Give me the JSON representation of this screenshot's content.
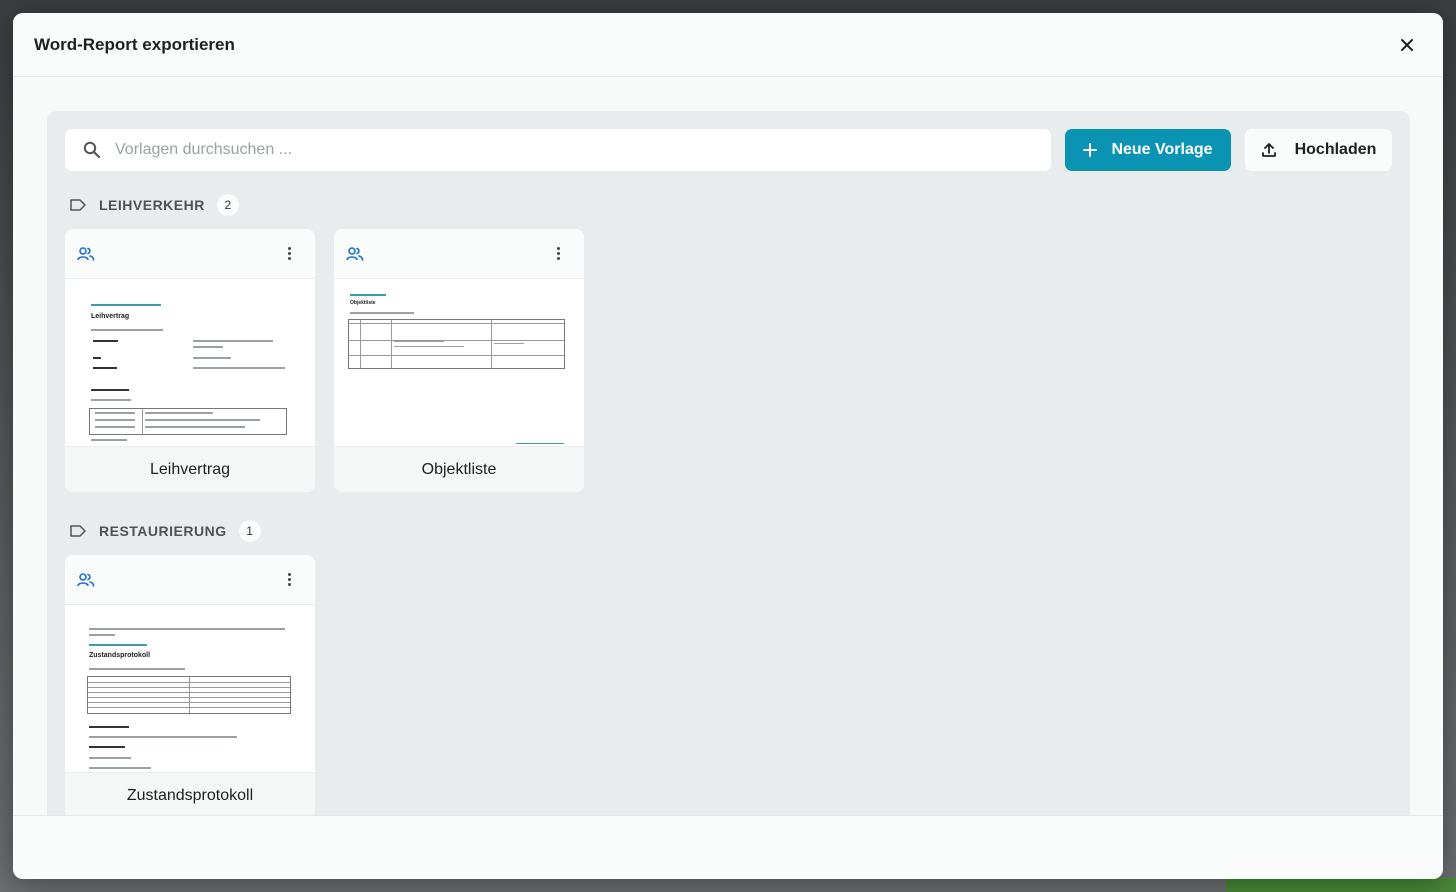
{
  "modal": {
    "title": "Word-Report exportieren"
  },
  "toolbar": {
    "search_placeholder": "Vorlagen durchsuchen ...",
    "new_template_label": "Neue Vorlage",
    "upload_label": "Hochladen"
  },
  "groups": [
    {
      "label": "LEIHVERKEHR",
      "count": "2",
      "templates": [
        {
          "name": "Leihvertrag",
          "preview_title": "Leihvertrag"
        },
        {
          "name": "Objektliste",
          "preview_title": "Objektliste"
        }
      ]
    },
    {
      "label": "RESTAURIERUNG",
      "count": "1",
      "templates": [
        {
          "name": "Zustandsprotokoll",
          "preview_title": "Zustandsprotokoll"
        }
      ]
    }
  ],
  "icons": {
    "close": "close-icon",
    "search": "search-icon",
    "plus": "plus-icon",
    "upload": "upload-icon",
    "tag": "tag-icon",
    "users": "users-icon",
    "more": "more-vertical-icon"
  },
  "colors": {
    "primary": "#0b93b4",
    "users_icon": "#1f6fd1"
  }
}
